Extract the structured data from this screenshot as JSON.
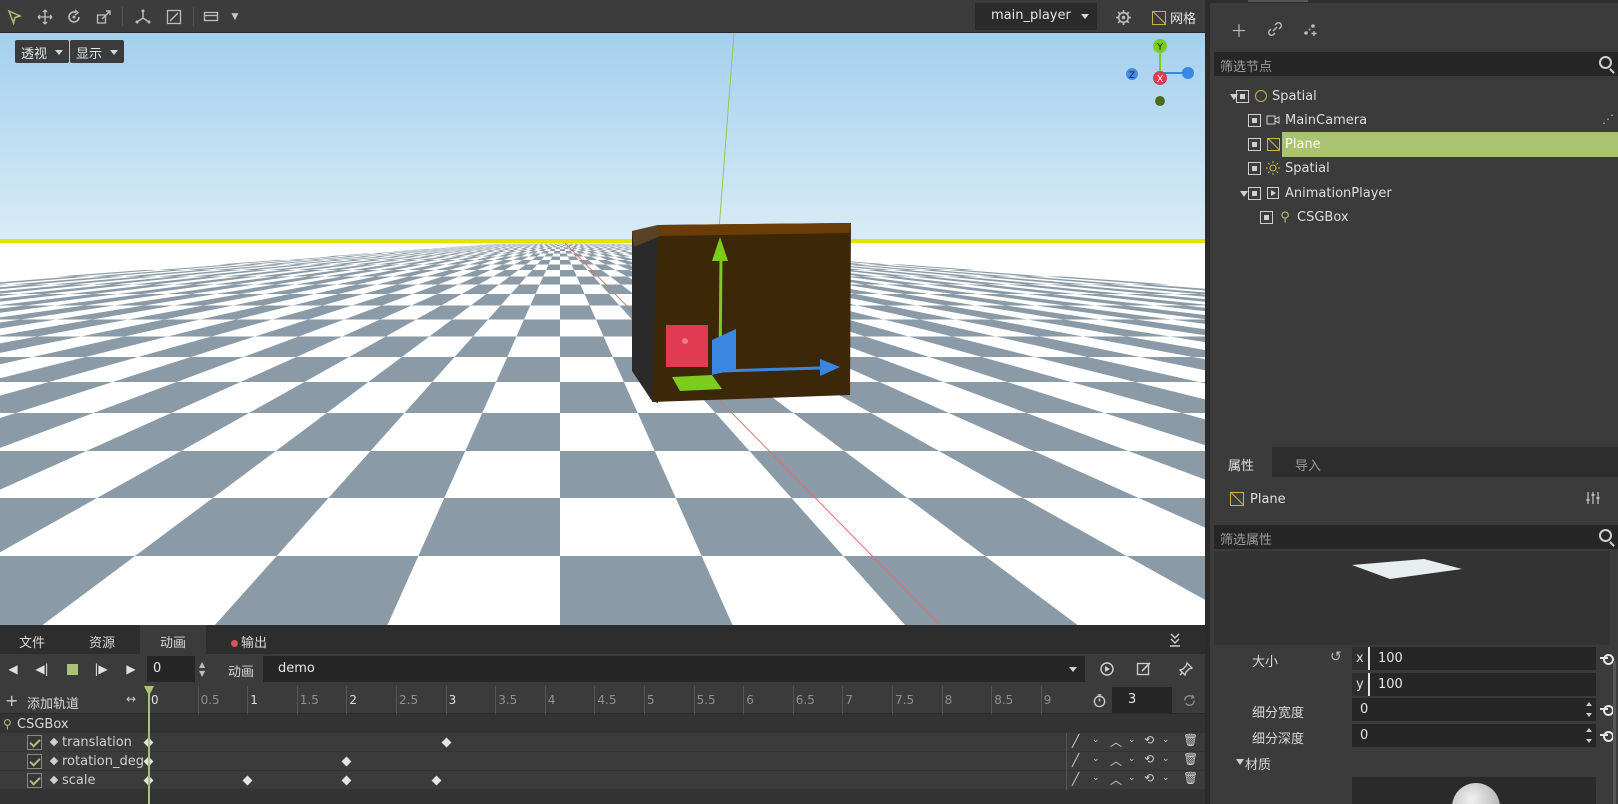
{
  "toolbar": {
    "player_select": "main_player",
    "grid_label": "网格"
  },
  "viewport": {
    "menu_view": "透视",
    "menu_show": "显示",
    "gizmo": {
      "y": "Y",
      "x": "X",
      "z": "Z"
    }
  },
  "scene": {
    "filter_placeholder": "筛选节点",
    "nodes": [
      {
        "label": "Spatial",
        "icon": "circle-icon",
        "expanded": true
      },
      {
        "label": "MainCamera",
        "icon": "camera-icon"
      },
      {
        "label": "Plane",
        "icon": "mesh-icon",
        "selected": true
      },
      {
        "label": "Spatial",
        "icon": "light-icon"
      },
      {
        "label": "AnimationPlayer",
        "icon": "animation-icon",
        "expanded": true
      },
      {
        "label": "CSGBox",
        "icon": "csg-icon"
      }
    ]
  },
  "inspector": {
    "tabs": [
      "属性",
      "导入"
    ],
    "object_label": "Plane",
    "filter_placeholder": "筛选属性",
    "size_label": "大小",
    "size_x": "100",
    "size_y": "100",
    "axis_x": "x",
    "axis_y": "y",
    "subdiv_width_label": "细分宽度",
    "subdiv_width": "0",
    "subdiv_depth_label": "细分深度",
    "subdiv_depth": "0",
    "material_label": "材质"
  },
  "bottom": {
    "tabs": [
      "文件",
      "资源",
      "动画",
      "输出"
    ],
    "active_tab": "动画",
    "current_time": "0",
    "anim_label": "动画",
    "anim_name": "demo",
    "add_track": "添加轨道",
    "length": "3",
    "ticks": [
      "0",
      "0.5",
      "1",
      "1.5",
      "2",
      "2.5",
      "3",
      "3.5",
      "4",
      "4.5",
      "5",
      "5.5",
      "6",
      "6.5",
      "7",
      "7.5",
      "8",
      "8.5",
      "9"
    ],
    "group_label": "CSGBox",
    "tracks": [
      {
        "name": "translation",
        "keys": [
          0,
          3
        ]
      },
      {
        "name": "rotation_degrees",
        "keys": [
          0,
          2
        ]
      },
      {
        "name": "scale",
        "keys": [
          0,
          1,
          2,
          2.9
        ]
      }
    ]
  },
  "colors": {
    "accent": "#a9c373",
    "sky": "#aed6ee",
    "box": "#3f2a08",
    "record_dot": "#e0505a"
  }
}
